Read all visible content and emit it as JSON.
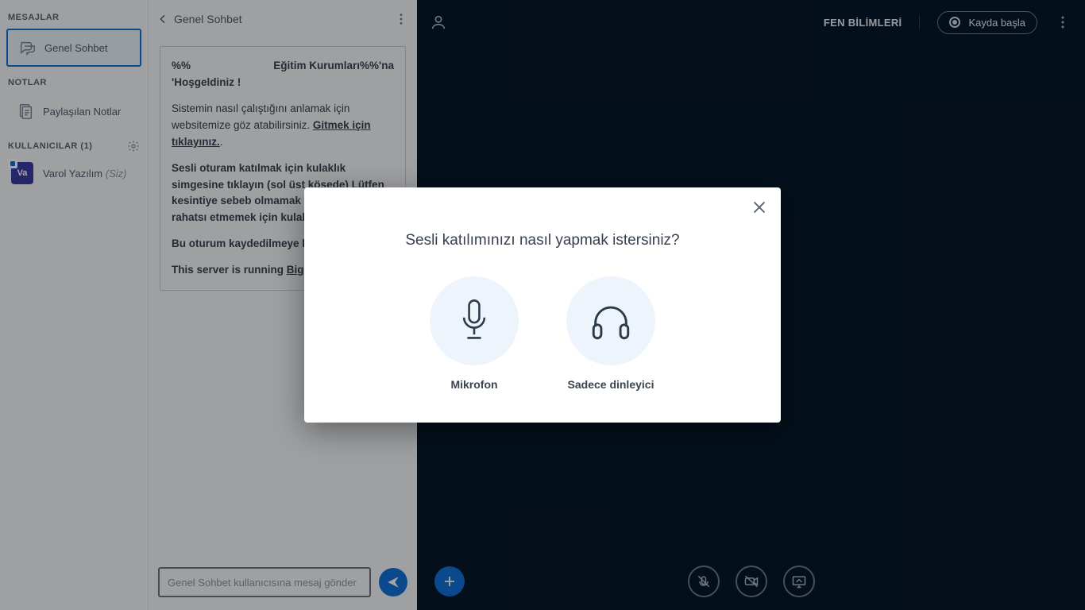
{
  "sidebar": {
    "messagesHeader": "MESAJLAR",
    "generalChat": "Genel Sohbet",
    "notesHeader": "NOTLAR",
    "sharedNotes": "Paylaşılan Notlar",
    "usersHeader": "KULLANICILAR (1)",
    "user": {
      "initials": "Va",
      "name": "Varol Yazılım",
      "you": "(Siz)"
    }
  },
  "chat": {
    "title": "Genel Sohbet",
    "welcome": {
      "line1_left": "%%",
      "line1_right": "Eğitim Kurumları%%'na",
      "line2": "'Hoşgeldiniz !",
      "p2a": "Sistemin nasıl çalıştığını anlamak için websitemize göz atabilirsiniz. ",
      "p2link": "Gitmek için tıklayınız.",
      "p2end": ".",
      "p3": "Sesli oturam katılmak için kulaklık simgesine tıklayın (sol üst köşede) Lütfen kesintiye sebeb olmamak ve başkalarını rahatsı etmemek için kulaklık kullanın.",
      "p4": "Bu oturum kaydedilmeye başladı.",
      "p5a": "This server is running ",
      "p5link": "BigBlu"
    },
    "placeholder": "Genel Sohbet kullanıcısına mesaj gönder"
  },
  "stage": {
    "course": "FEN BİLİMLERİ",
    "recordLabel": "Kayda başla"
  },
  "modal": {
    "title": "Sesli katılımınızı nasıl yapmak istersiniz?",
    "micLabel": "Mikrofon",
    "listenLabel": "Sadece dinleyici"
  }
}
